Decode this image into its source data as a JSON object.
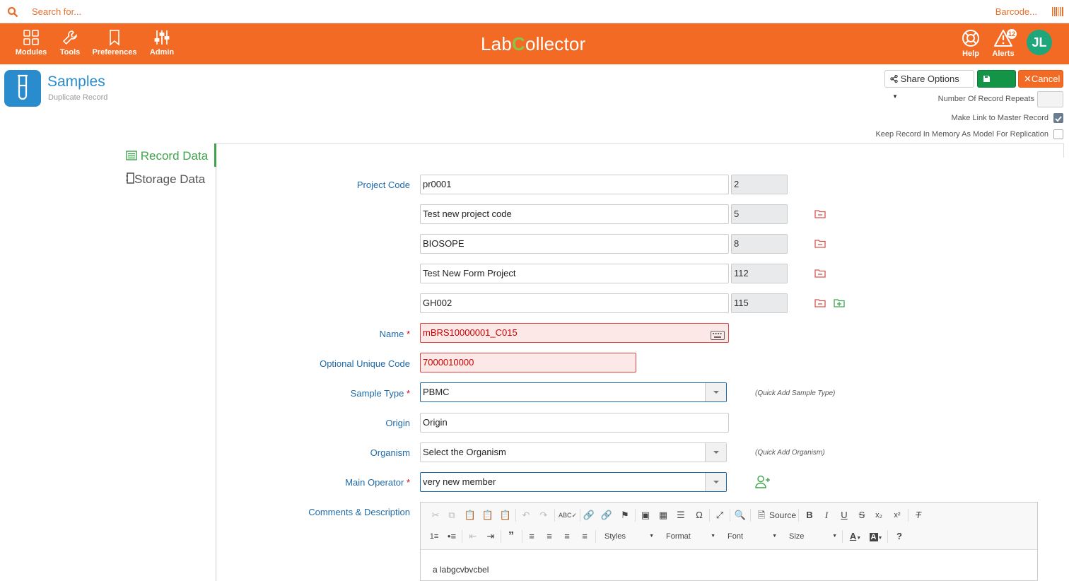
{
  "search": {
    "placeholder": "Search for...",
    "barcode_label": "Barcode..."
  },
  "header": {
    "nav": [
      {
        "label": "Modules",
        "icon": "grid-icon"
      },
      {
        "label": "Tools",
        "icon": "wrench-icon"
      },
      {
        "label": "Preferences",
        "icon": "bookmark-icon"
      },
      {
        "label": "Admin",
        "icon": "sliders-icon"
      }
    ],
    "logo_pre": "Lab",
    "logo_c": "C",
    "logo_post": "ollector",
    "help_label": "Help",
    "alerts_label": "Alerts",
    "alerts_count": "12",
    "avatar_initials": "JL",
    "brand_color": "#f26a23"
  },
  "module": {
    "title": "Samples",
    "subtitle": "Duplicate Record"
  },
  "actions": {
    "share_label": "Share Options",
    "save_label": "Save",
    "cancel_label": "Cancel"
  },
  "options": {
    "repeats_label": "Number Of Record Repeats",
    "repeats_value": "",
    "link_master_label": "Make Link to Master Record",
    "link_master_checked": true,
    "keep_memory_label": "Keep Record In Memory As Model For Replication",
    "keep_memory_checked": false
  },
  "tabs": {
    "record_data": "Record Data",
    "storage_data": "Storage Data"
  },
  "form": {
    "project_code_label": "Project Code",
    "projects": [
      {
        "name": "pr0001",
        "id": "2"
      },
      {
        "name": "Test new project code",
        "id": "5"
      },
      {
        "name": "BIOSOPE",
        "id": "8"
      },
      {
        "name": "Test New Form Project",
        "id": "112"
      },
      {
        "name": "GH002",
        "id": "115"
      }
    ],
    "name_label": "Name",
    "name_value": "mBRS10000001_C015",
    "unique_code_label": "Optional Unique Code",
    "unique_code_value": "7000010000",
    "sample_type_label": "Sample Type",
    "sample_type_value": "PBMC",
    "quick_add_sample_type": "(Quick Add Sample Type)",
    "origin_label": "Origin",
    "origin_value": "Origin",
    "organism_label": "Organism",
    "organism_value": "Select the Organism",
    "quick_add_organism": "(Quick Add Organism)",
    "operator_label": "Main Operator",
    "operator_value": "very new member",
    "comments_label": "Comments & Description",
    "required_mark": "*"
  },
  "editor": {
    "source_label": "Source",
    "styles_label": "Styles",
    "format_label": "Format",
    "font_label": "Font",
    "size_label": "Size",
    "content": "a labgcvbvcbel"
  }
}
